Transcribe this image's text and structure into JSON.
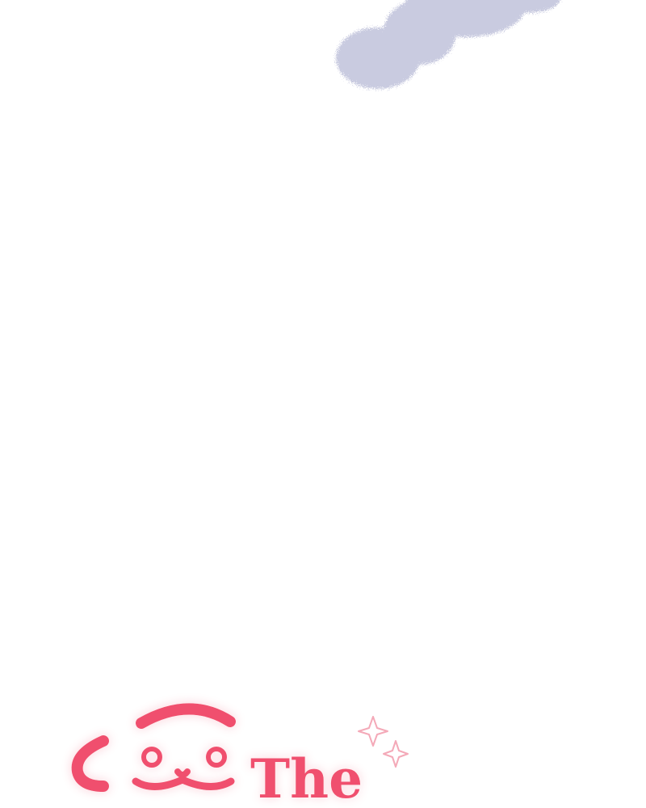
{
  "logo": {
    "word": "The",
    "primary_color": "#f0506e",
    "glow_color": "#fde3e8",
    "sparkle_color": "#f4a9b8"
  },
  "decoration": {
    "blob_color": "#c9cbe0"
  }
}
